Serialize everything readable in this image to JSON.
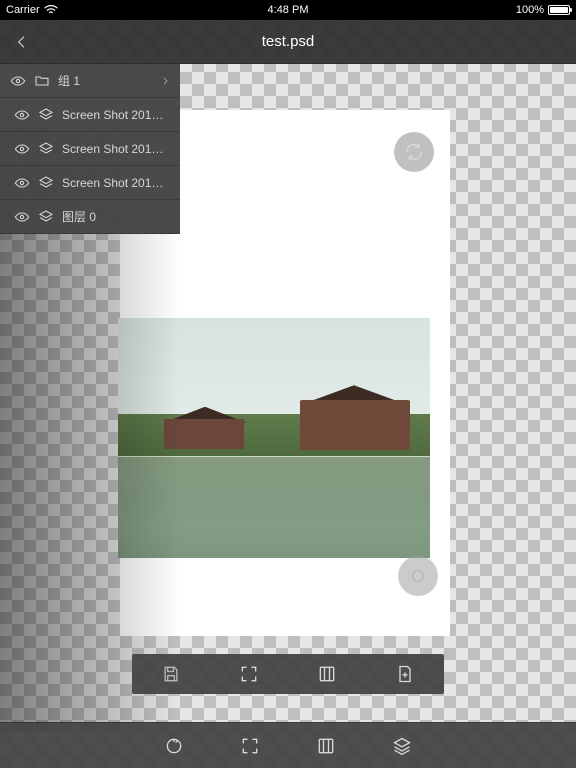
{
  "statusbar": {
    "carrier": "Carrier",
    "time": "4:48 PM",
    "battery": "100%"
  },
  "navbar": {
    "title": "test.psd"
  },
  "layers": {
    "items": [
      {
        "label": "组 1",
        "kind": "group",
        "expandable": true
      },
      {
        "label": "Screen Shot 2017-...",
        "kind": "layer"
      },
      {
        "label": "Screen Shot 2017-...",
        "kind": "layer"
      },
      {
        "label": "Screen Shot 2017-...",
        "kind": "layer"
      },
      {
        "label": "图层 0",
        "kind": "layer"
      }
    ]
  },
  "icons": {
    "back": "chevron-left-icon",
    "eye": "eye-icon",
    "folder": "folder-icon",
    "layer": "layers-icon",
    "chevron_right": "chevron-right-icon",
    "sync": "sync-icon",
    "circle_toggle": "circle-icon",
    "save": "save-icon",
    "expand": "expand-icon",
    "resize": "resize-icon",
    "add_page": "add-page-icon",
    "rotate": "rotate-icon",
    "stack": "layer-stack-icon"
  },
  "colors": {
    "panel": "#464646",
    "navbar": "#333333",
    "icon": "#d9d9d9"
  }
}
